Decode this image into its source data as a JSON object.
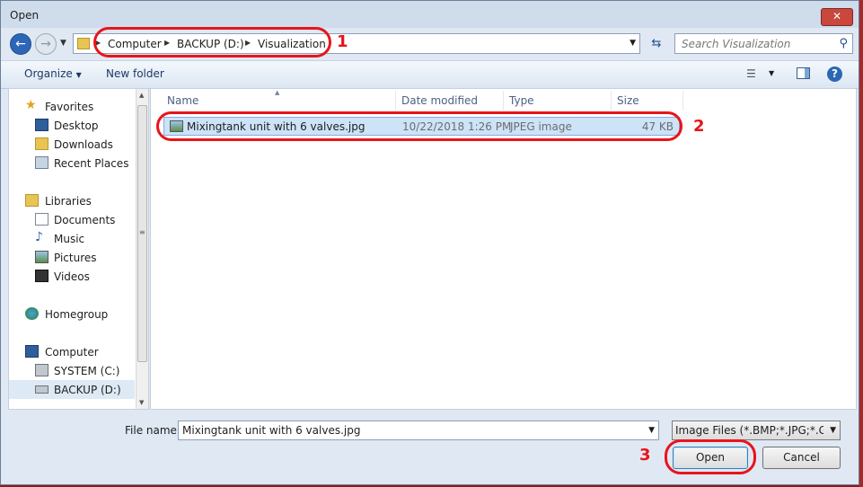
{
  "window": {
    "title": "Open",
    "close_symbol": "✕"
  },
  "address_bar": {
    "crumbs": [
      "Computer",
      "BACKUP (D:)",
      "Visualization"
    ],
    "search_placeholder": "Search Visualization"
  },
  "toolbar": {
    "organize": "Organize",
    "new_folder": "New folder"
  },
  "nav": {
    "favorites": {
      "label": "Favorites",
      "items": [
        "Desktop",
        "Downloads",
        "Recent Places"
      ]
    },
    "libraries": {
      "label": "Libraries",
      "items": [
        "Documents",
        "Music",
        "Pictures",
        "Videos"
      ]
    },
    "homegroup": "Homegroup",
    "computer": {
      "label": "Computer",
      "items": [
        "SYSTEM (C:)",
        "BACKUP (D:)"
      ]
    },
    "selected": "BACKUP (D:)"
  },
  "file_list": {
    "columns": [
      "Name",
      "Date modified",
      "Type",
      "Size"
    ],
    "rows": [
      {
        "name": "Mixingtank unit with 6 valves.jpg",
        "date": "10/22/2018 1:26 PM",
        "type": "JPEG image",
        "size": "47 KB"
      }
    ]
  },
  "bottom": {
    "file_name_label": "File name:",
    "file_name_value": "Mixingtank unit with 6 valves.jpg",
    "file_type_value": "Image Files (*.BMP;*.JPG;*.GIF,*",
    "open_label": "Open",
    "cancel_label": "Cancel"
  },
  "annotations": {
    "n1": "1",
    "n2": "2",
    "n3": "3",
    "color": "#e8141b"
  }
}
